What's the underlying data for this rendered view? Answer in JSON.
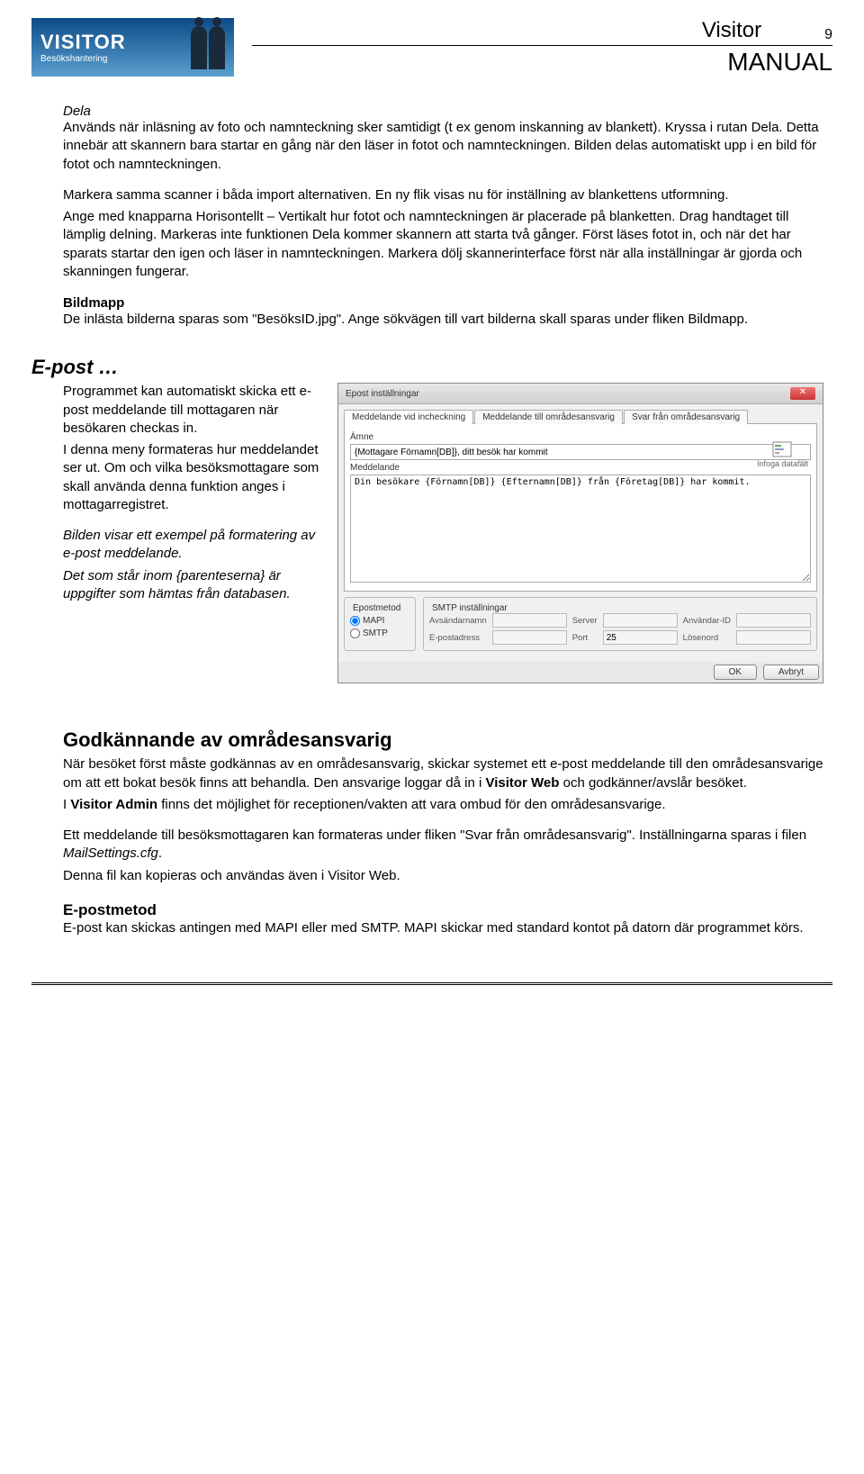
{
  "header": {
    "logo_title": "VISITOR",
    "logo_sub": "Besökshantering",
    "doc_title1": "Visitor",
    "doc_title2": "MANUAL",
    "page_num": "9"
  },
  "dela": {
    "title": "Dela",
    "body": "Används när inläsning av foto och namnteckning sker samtidigt (t ex genom inskanning av blankett). Kryssa i rutan Dela. Detta innebär att skannern bara startar en gång när den läser in fotot och namnteckningen. Bilden delas automatiskt upp i en bild för fotot och namnteckningen.",
    "body2": "Markera samma scanner i båda import alternativen. En ny flik visas nu för inställning av blankettens utformning.",
    "body3": "Ange med knapparna Horisontellt – Vertikalt hur fotot och namnteckningen är placerade på blanketten. Drag handtaget till lämplig delning. Markeras inte funktionen Dela kommer skannern att starta två gånger. Först läses fotot in, och när det har sparats startar den igen och läser in namnteckningen. Markera dölj skannerinterface först när alla inställningar är gjorda och skanningen fungerar."
  },
  "bildmapp": {
    "title": "Bildmapp",
    "body": "De inlästa bilderna sparas som \"BesöksID.jpg\". Ange sökvägen till vart bilderna skall sparas under fliken Bildmapp."
  },
  "epost": {
    "title": "E-post …",
    "body1": "Programmet kan automatiskt skicka ett e-post meddelande till mottagaren när besökaren checkas in.",
    "body2": "I denna meny formateras hur meddelandet ser ut. Om och vilka besöksmottagare som skall använda denna funktion anges i mottagarregistret.",
    "body3_italic": "Bilden visar ett exempel på formatering av e-post meddelande.",
    "body4_italic": "Det som står inom {parenteserna} är uppgifter som hämtas från databasen."
  },
  "dialog": {
    "title": "Epost inställningar",
    "tabs": [
      "Meddelande vid incheckning",
      "Meddelande till områdesansvarig",
      "Svar från områdesansvarig"
    ],
    "label_amne": "Ämne",
    "val_amne": "{Mottagare Förnamn[DB]}, ditt besök har kommit",
    "label_medd": "Meddelande",
    "val_medd": "Din besökare {Förnamn[DB]} {Efternamn[DB]} från {Företag[DB]} har kommit.",
    "insert_label": "Infoga datafält",
    "fs_epost": "Epostmetod",
    "radio_mapi": "MAPI",
    "radio_smtp": "SMTP",
    "fs_smtp": "SMTP inställningar",
    "l_avs": "Avsändarnamn",
    "l_server": "Server",
    "l_anvid": "Användar-ID",
    "l_eaddr": "E-postadress",
    "l_port": "Port",
    "v_port": "25",
    "l_losen": "Lösenord",
    "btn_ok": "OK",
    "btn_cancel": "Avbryt"
  },
  "godk": {
    "title": "Godkännande av områdesansvarig",
    "p1a": "När besöket först måste godkännas av en områdesansvarig, skickar systemet ett e-post meddelande till den områdesansvarige om att ett bokat besök finns att behandla. Den ansvarige loggar då in i ",
    "p1b": "Visitor Web",
    "p1c": " och godkänner/avslår besöket.",
    "p2a": "I ",
    "p2b": "Visitor Admin",
    "p2c": " finns det möjlighet för receptionen/vakten att vara ombud för den områdesansvarige.",
    "p3a": "Ett meddelande till besöksmottagaren kan formateras under fliken \"Svar från områdesansvarig\". Inställningarna sparas i filen ",
    "p3b": "MailSettings.cfg",
    "p3c": ".",
    "p4": "Denna fil kan kopieras och användas även i Visitor Web."
  },
  "emetod": {
    "title": "E-postmetod",
    "body": "E-post kan skickas antingen med MAPI eller med SMTP. MAPI skickar med standard kontot på datorn där programmet körs."
  }
}
